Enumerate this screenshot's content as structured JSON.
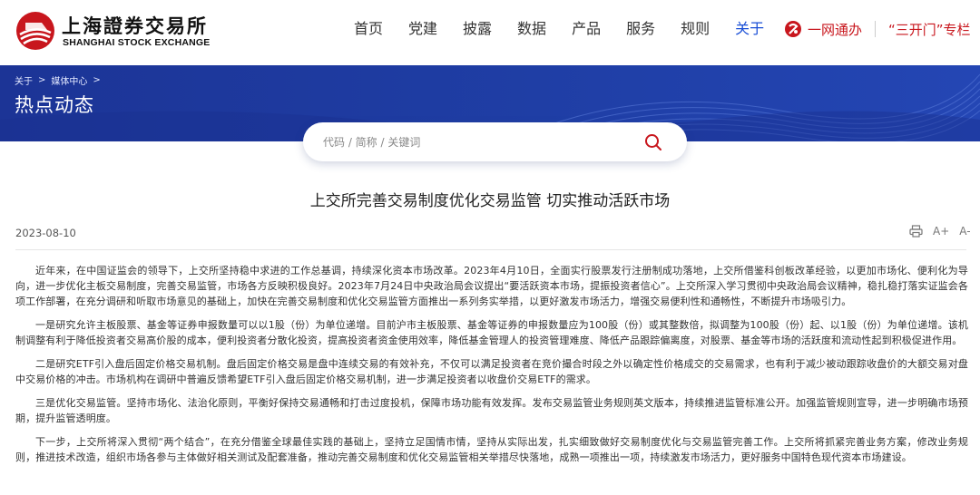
{
  "header": {
    "logo": {
      "cn": "上海證券交易所",
      "en": "SHANGHAI STOCK EXCHANGE",
      "icon": "sse-logo-icon"
    },
    "nav": [
      {
        "label": "首页",
        "active": false
      },
      {
        "label": "党建",
        "active": false
      },
      {
        "label": "披露",
        "active": false
      },
      {
        "label": "数据",
        "active": false
      },
      {
        "label": "产品",
        "active": false
      },
      {
        "label": "服务",
        "active": false
      },
      {
        "label": "规则",
        "active": false
      },
      {
        "label": "关于",
        "active": true
      }
    ],
    "quick_links": {
      "one_net_label": "一网通办",
      "one_net_icon": "one-net-icon",
      "three_open_label": "“三开门”专栏"
    }
  },
  "banner": {
    "breadcrumb": [
      "关于",
      "媒体中心"
    ],
    "title": "热点动态"
  },
  "search": {
    "placeholder": "代码 / 简称 / 关键词",
    "value": "",
    "icon": "search-icon"
  },
  "article": {
    "title": "上交所完善交易制度优化交易监管 切实推动活跃市场",
    "date": "2023-08-10",
    "tools": {
      "print_icon": "print-icon",
      "font_increase": "A+",
      "font_decrease": "A-"
    },
    "paragraphs": [
      "近年来，在中国证监会的领导下，上交所坚持稳中求进的工作总基调，持续深化资本市场改革。2023年4月10日，全面实行股票发行注册制成功落地，上交所借鉴科创板改革经验，以更加市场化、便利化为导向，进一步优化主板交易制度，完善交易监管，市场各方反映积极良好。2023年7月24日中央政治局会议提出“要活跃资本市场，提振投资者信心”。上交所深入学习贯彻中央政治局会议精神，稳扎稳打落实证监会各项工作部署，在充分调研和听取市场意见的基础上，加快在完善交易制度和优化交易监管方面推出一系列务实举措，以更好激发市场活力，增强交易便利性和通畅性，不断提升市场吸引力。",
      "一是研究允许主板股票、基金等证券申报数量可以以1股（份）为单位递增。目前沪市主板股票、基金等证券的申报数量应为100股（份）或其整数倍，拟调整为100股（份）起、以1股（份）为单位递增。该机制调整有利于降低投资者交易高价股的成本，便利投资者分散化投资，提高投资者资金使用效率，降低基金管理人的投资管理难度、降低产品跟踪偏离度，对股票、基金等市场的活跃度和流动性起到积极促进作用。",
      "二是研究ETF引入盘后固定价格交易机制。盘后固定价格交易是盘中连续交易的有效补充，不仅可以满足投资者在竞价撮合时段之外以确定性价格成交的交易需求，也有利于减少被动跟踪收盘价的大额交易对盘中交易价格的冲击。市场机构在调研中普遍反馈希望ETF引入盘后固定价格交易机制，进一步满足投资者以收盘价交易ETF的需求。",
      "三是优化交易监管。坚持市场化、法治化原则，平衡好保持交易通畅和打击过度投机，保障市场功能有效发挥。发布交易监管业务规则英文版本，持续推进监管标准公开。加强监管规则宣导，进一步明确市场预期，提升监管透明度。",
      "下一步，上交所将深入贯彻“两个结合”，在充分借鉴全球最佳实践的基础上，坚持立足国情市情，坚持从实际出发，扎实细致做好交易制度优化与交易监管完善工作。上交所将抓紧完善业务方案，修改业务规则，推进技术改造，组织市场各参与主体做好相关测试及配套准备，推动完善交易制度和优化交易监管相关举措尽快落地，成熟一项推出一项，持续激发市场活力，更好服务中国特色现代资本市场建设。"
    ]
  },
  "colors": {
    "brand_red": "#c8161d",
    "nav_active": "#1a4fd6",
    "banner_blue": "#1f3ea5"
  }
}
